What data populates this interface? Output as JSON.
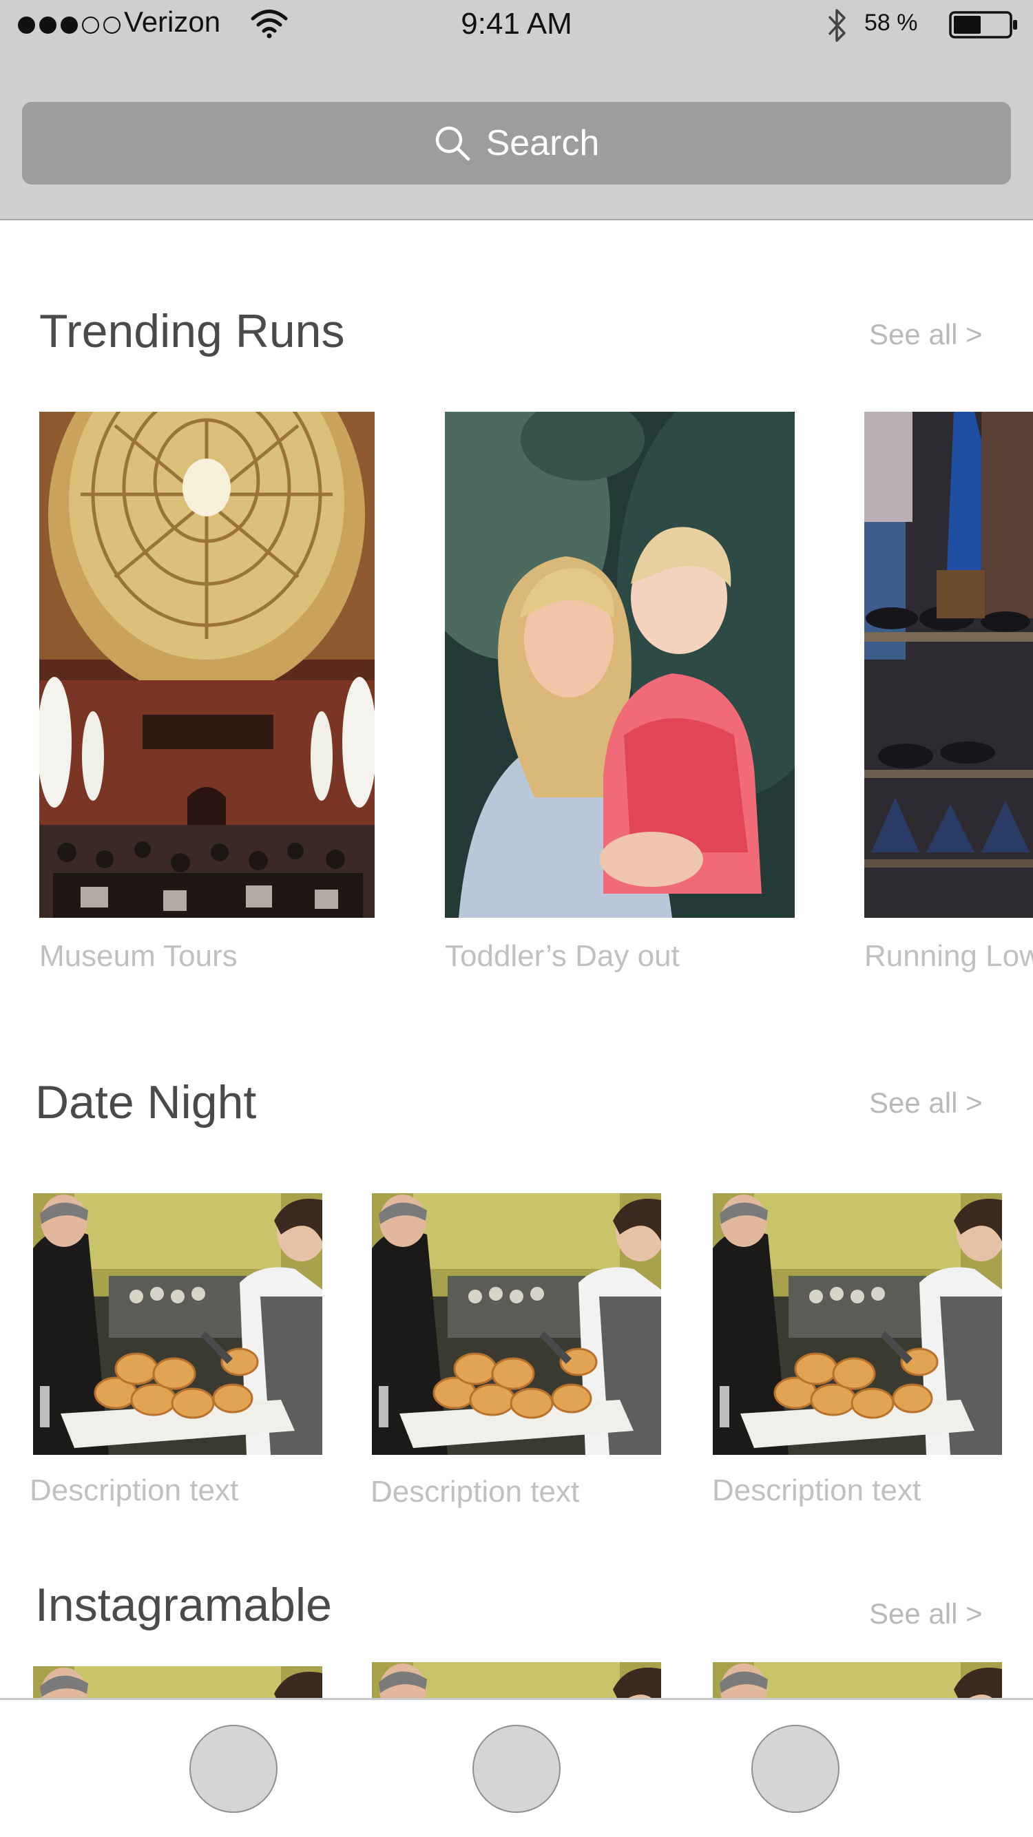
{
  "status_bar": {
    "carrier": "Verizon",
    "time": "9:41 AM",
    "battery_percent": "58 %",
    "battery_level": 0.5,
    "signal_strength": "3 of 5",
    "icons": [
      "signal-dots-icon",
      "wifi-icon",
      "bluetooth-icon",
      "battery-icon"
    ]
  },
  "search": {
    "label": "Search",
    "icon": "search-icon"
  },
  "sections": [
    {
      "title": "Trending Runs",
      "see_all": "See all >",
      "items": [
        {
          "caption": "Museum Tours",
          "image": "domed-market-hall-photo"
        },
        {
          "caption": "Toddler’s Day out",
          "image": "mother-and-toddler-photo"
        },
        {
          "caption": "Running Low",
          "image": "shoe-shop-shelves-photo"
        }
      ]
    },
    {
      "title": "Date Night",
      "see_all": "See all >",
      "items": [
        {
          "caption": "Description text",
          "image": "bakery-scones-photo"
        },
        {
          "caption": "Description text",
          "image": "bakery-scones-photo"
        },
        {
          "caption": "Description text",
          "image": "bakery-scones-photo"
        }
      ]
    },
    {
      "title": "Instagramable",
      "see_all": "See all >",
      "items": [
        {
          "image": "bakery-scones-photo"
        },
        {
          "image": "bakery-scones-photo"
        },
        {
          "image": "bakery-scones-photo"
        }
      ]
    }
  ],
  "tab_bar": {
    "tabs": [
      "tab-1",
      "tab-2",
      "tab-3"
    ]
  },
  "colors": {
    "header_bg": "#cfcfcf",
    "search_bg": "#9d9d9d",
    "title_text": "#4a4a4a",
    "muted_text": "#b9b9b9",
    "tab_circle": "#d5d5d5"
  }
}
